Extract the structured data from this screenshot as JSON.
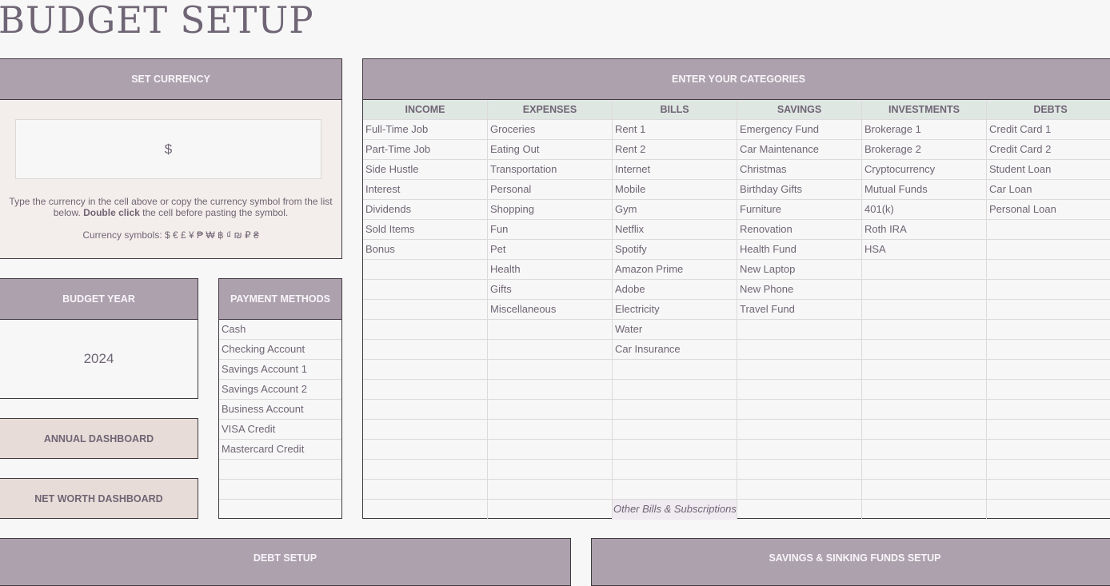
{
  "page": {
    "title": "BUDGET SETUP"
  },
  "currency": {
    "header": "SET CURRENCY",
    "value": "$",
    "help_pre": "Type the currency in the cell above or copy the currency symbol from the list below. ",
    "help_bold": "Double click",
    "help_post": " the cell before pasting the symbol.",
    "symbols_label": "Currency symbols:",
    "symbols": "$ € £ ¥ ₱ ₩ ฿ ₫ ₪ ₽ ₴"
  },
  "budget_year": {
    "header": "BUDGET YEAR",
    "value": "2024"
  },
  "dashboards": {
    "annual": "ANNUAL DASHBOARD",
    "net_worth": "NET WORTH DASHBOARD"
  },
  "payment_methods": {
    "header": "PAYMENT METHODS",
    "items": [
      "Cash",
      "Checking Account",
      "Savings Account 1",
      "Savings Account 2",
      "Business Account",
      "VISA Credit",
      "Mastercard Credit",
      "",
      "",
      ""
    ]
  },
  "categories": {
    "header": "ENTER YOUR CATEGORIES",
    "columns": [
      {
        "label": "INCOME",
        "items": [
          "Full-Time Job",
          "Part-Time Job",
          "Side Hustle",
          "Interest",
          "Dividends",
          "Sold Items",
          "Bonus"
        ]
      },
      {
        "label": "EXPENSES",
        "items": [
          "Groceries",
          "Eating Out",
          "Transportation",
          "Personal",
          "Shopping",
          "Fun",
          "Pet",
          "Health",
          "Gifts",
          "Miscellaneous"
        ]
      },
      {
        "label": "BILLS",
        "items": [
          "Rent 1",
          "Rent 2",
          "Internet",
          "Mobile",
          "Gym",
          "Netflix",
          "Spotify",
          "Amazon Prime",
          "Adobe",
          "Electricity",
          "Water",
          "Car Insurance"
        ],
        "footer": "Other Bills & Subscriptions"
      },
      {
        "label": "SAVINGS",
        "items": [
          "Emergency Fund",
          "Car Maintenance",
          "Christmas",
          "Birthday Gifts",
          "Furniture",
          "Renovation",
          "Health Fund",
          "New Laptop",
          "New Phone",
          "Travel Fund"
        ]
      },
      {
        "label": "INVESTMENTS",
        "items": [
          "Brokerage 1",
          "Brokerage 2",
          "Cryptocurrency",
          "Mutual Funds",
          "401(k)",
          "Roth IRA",
          "HSA"
        ]
      },
      {
        "label": "DEBTS",
        "items": [
          "Credit Card 1",
          "Credit Card 2",
          "Student Loan",
          "Car Loan",
          "Personal Loan"
        ]
      }
    ]
  },
  "bottom": {
    "debt_setup": "DEBT SETUP",
    "savings_setup": "SAVINGS & SINKING FUNDS SETUP"
  }
}
